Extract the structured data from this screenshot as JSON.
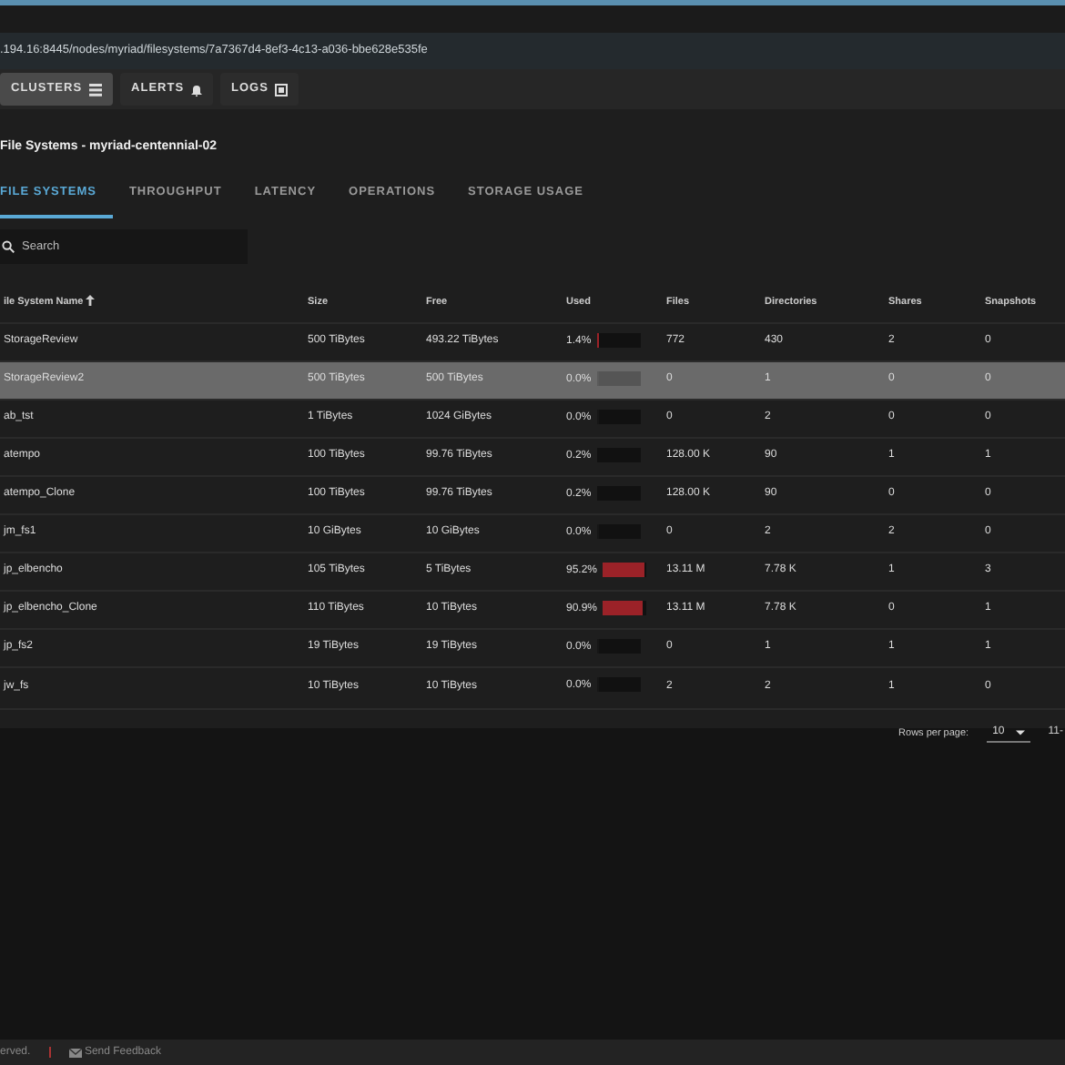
{
  "address_bar": {
    "url": ".194.16:8445/nodes/myriad/filesystems/7a7367d4-8ef3-4c13-a036-bbe628e535fe"
  },
  "nav_buttons": [
    {
      "label": "CLUSTERS",
      "selected": true
    },
    {
      "label": "ALERTS",
      "selected": false
    },
    {
      "label": "LOGS",
      "selected": false
    }
  ],
  "page_title": "File Systems - myriad-centennial-02",
  "tabs": [
    {
      "label": "FILE SYSTEMS",
      "selected": true
    },
    {
      "label": "THROUGHPUT",
      "selected": false
    },
    {
      "label": "LATENCY",
      "selected": false
    },
    {
      "label": "OPERATIONS",
      "selected": false
    },
    {
      "label": "STORAGE USAGE",
      "selected": false
    }
  ],
  "search": {
    "placeholder": "Search"
  },
  "table": {
    "columns": [
      "ile System Name",
      "Size",
      "Free",
      "Used",
      "Files",
      "Directories",
      "Shares",
      "Snapshots"
    ],
    "rows": [
      {
        "name": "StorageReview",
        "size": "500 TiBytes",
        "free": "493.22 TiBytes",
        "used": "1.4%",
        "level": 0.014,
        "files": "772",
        "directories": "430",
        "shares": "2",
        "snapshots": "0",
        "selected": false
      },
      {
        "name": "StorageReview2",
        "size": "500 TiBytes",
        "free": "500 TiBytes",
        "used": "0.0%",
        "level": 0,
        "files": "0",
        "directories": "1",
        "shares": "0",
        "snapshots": "0",
        "selected": true
      },
      {
        "name": "ab_tst",
        "size": "1 TiBytes",
        "free": "1024 GiBytes",
        "used": "0.0%",
        "level": 0,
        "files": "0",
        "directories": "2",
        "shares": "0",
        "snapshots": "0",
        "selected": false
      },
      {
        "name": "atempo",
        "size": "100 TiBytes",
        "free": "99.76 TiBytes",
        "used": "0.2%",
        "level": 0.002,
        "files": "128.00 K",
        "directories": "90",
        "shares": "1",
        "snapshots": "1",
        "selected": false
      },
      {
        "name": "atempo_Clone",
        "size": "100 TiBytes",
        "free": "99.76 TiBytes",
        "used": "0.2%",
        "level": 0.002,
        "files": "128.00 K",
        "directories": "90",
        "shares": "0",
        "snapshots": "0",
        "selected": false
      },
      {
        "name": "jm_fs1",
        "size": "10 GiBytes",
        "free": "10 GiBytes",
        "used": "0.0%",
        "level": 0,
        "files": "0",
        "directories": "2",
        "shares": "2",
        "snapshots": "0",
        "selected": false
      },
      {
        "name": "jp_elbencho",
        "size": "105 TiBytes",
        "free": "5 TiBytes",
        "used": "95.2%",
        "level": 0.952,
        "files": "13.11 M",
        "directories": "7.78 K",
        "shares": "1",
        "snapshots": "3",
        "selected": false
      },
      {
        "name": "jp_elbencho_Clone",
        "size": "110 TiBytes",
        "free": "10 TiBytes",
        "used": "90.9%",
        "level": 0.909,
        "files": "13.11 M",
        "directories": "7.78 K",
        "shares": "0",
        "snapshots": "1",
        "selected": false
      },
      {
        "name": "jp_fs2",
        "size": "19 TiBytes",
        "free": "19 TiBytes",
        "used": "0.0%",
        "level": 0,
        "files": "0",
        "directories": "1",
        "shares": "1",
        "snapshots": "1",
        "selected": false
      },
      {
        "name": "jw_fs",
        "size": "10 TiBytes",
        "free": "10 TiBytes",
        "used": "0.0%",
        "level": 0,
        "files": "2",
        "directories": "2",
        "shares": "1",
        "snapshots": "0",
        "selected": false
      }
    ]
  },
  "pagination": {
    "rows_per_page_label": "Rows per page:",
    "rows_per_page": "10",
    "range": "11-"
  },
  "footer": {
    "copyright": "erved.",
    "feedback": "Send Feedback"
  }
}
